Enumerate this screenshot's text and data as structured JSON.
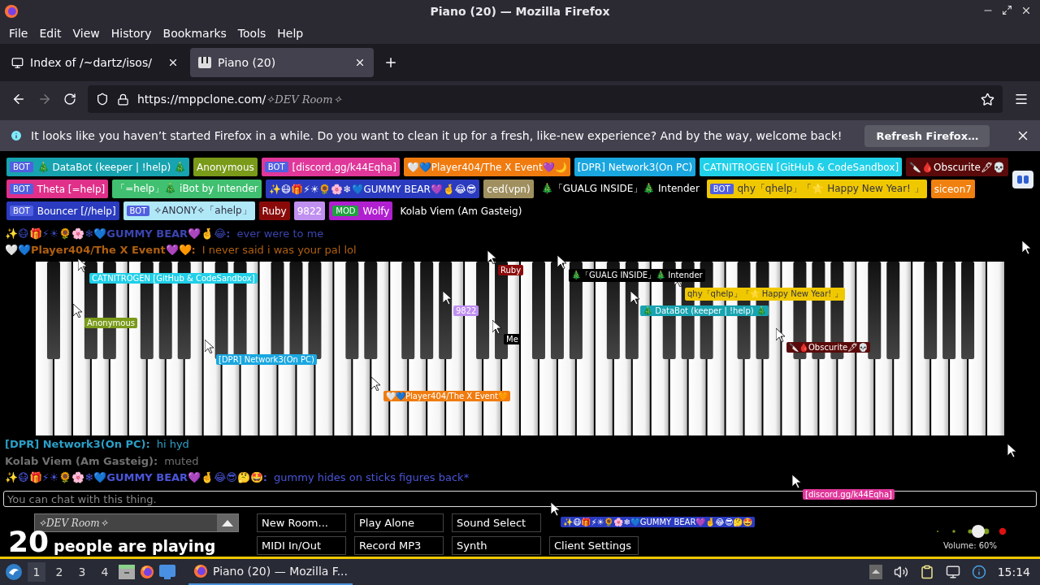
{
  "window": {
    "title": "Piano (20) — Mozilla Firefox"
  },
  "menu": [
    "File",
    "Edit",
    "View",
    "History",
    "Bookmarks",
    "Tools",
    "Help"
  ],
  "tabs": [
    {
      "label": "Index of /~dartz/isos/",
      "selected": false
    },
    {
      "label": "Piano (20)",
      "selected": true
    }
  ],
  "address": {
    "host": "https://mppclone.com/",
    "room": "✧DEV Room✧"
  },
  "notification": {
    "message": "It looks like you haven’t started Firefox in a while. Do you want to clean it up for a fresh, like-new experience? And by the way, welcome back!",
    "button": "Refresh Firefox…"
  },
  "users": [
    {
      "badge": {
        "label": "BOT",
        "color": "#5060e0"
      },
      "name": "🎄 DataBot (keeper | !help) 🎄",
      "color": "#17a3b0"
    },
    {
      "name": "Anonymous",
      "color": "#7a9a1a"
    },
    {
      "badge": {
        "label": "BOT",
        "color": "#5060e0"
      },
      "name": "[discord.gg/k44Eqha]",
      "color": "#e0379a"
    },
    {
      "name": "🤍💙Player404/The X Event💜🌙",
      "color": "#f07c10"
    },
    {
      "name": "[DPR] Network3(On PC)",
      "color": "#1aa7e0"
    },
    {
      "name": "CATNITROGEN [GitHub & CodeSandbox]",
      "color": "#20d0e8"
    },
    {
      "name": "🔪🩸Obscurite🖋💀",
      "color": "#5a0a0a"
    },
    {
      "badge": {
        "label": "BOT",
        "color": "#5060e0"
      },
      "name": "Theta [=help]",
      "color": "#e0308a"
    },
    {
      "name": "「=help」🎄 iBot by Intender",
      "color": "#40c070"
    },
    {
      "name": "✨😷🎁⚡☀🌻🌸❄💙GUMMY BEAR💜🤞😂😎",
      "color": "#2a3bc0"
    },
    {
      "name": "ced(vpn)",
      "color": "#a09060"
    },
    {
      "name": "🎄「GUALG INSIDE」🎄 Intender",
      "color": "#000000"
    },
    {
      "badge": {
        "label": "BOT",
        "color": "#5060e0"
      },
      "name": "qhy「qhelp」「🌟 Happy New Year! 」",
      "color": "#f0c800"
    },
    {
      "name": "siceon7",
      "color": "#f08010"
    },
    {
      "badge": {
        "label": "BOT",
        "color": "#5060e0"
      },
      "name": "Bouncer [//help]",
      "color": "#2a3bc0"
    },
    {
      "badge": {
        "label": "BOT",
        "color": "#5060e0"
      },
      "name": "✧ANONY✧「ahelp」",
      "color": "#b0e8f8"
    },
    {
      "name": "Ruby",
      "color": "#8a0a0a"
    },
    {
      "name": "9822",
      "color": "#c090f0"
    },
    {
      "badge": {
        "label": "MOD",
        "color": "#20a040"
      },
      "name": "Wolfy",
      "color": "#b020d0"
    },
    {
      "name": "Kolab Viem (Am Gasteig)",
      "color": "#000000"
    }
  ],
  "cursors": [
    {
      "label": "CATNITROGEN [GitHub & CodeSandbox]",
      "color": "#20d0e8"
    },
    {
      "label": "Ruby",
      "color": "#8a0a0a"
    },
    {
      "label": "🎄「GUALG INSIDE」🎄 Intender",
      "color": "#000000"
    },
    {
      "label": "Anonymous",
      "color": "#7a9a1a"
    },
    {
      "label": "9822",
      "color": "#c090f0"
    },
    {
      "label": "Me",
      "color": "#000000"
    },
    {
      "label": "🔪🩸Obscurite🖋💀",
      "color": "#5a0a0a"
    },
    {
      "label": "[DPR] Network3(On PC)",
      "color": "#1aa7e0"
    },
    {
      "label": "qhy「qhelp」「🌟 Happy New Year! 」",
      "color": "#f0c800"
    },
    {
      "label": "🎄 DataBot (keeper | !help) 🎄",
      "color": "#17a3b0"
    },
    {
      "label": "🤍💙Player404/The X Event🧡",
      "color": "#f07c10"
    },
    {
      "label": "[discord.gg/k44Eqha]",
      "color": "#e0379a"
    },
    {
      "label": "✨😷🎁⚡☀🌻🌸❄💙GUMMY BEAR💜🤞😂😎🤔🤩",
      "color": "#2a3bc0"
    }
  ],
  "chat_above": [
    {
      "name": "✨😷🎁⚡☀🌻🌸❄💙GUMMY BEAR💜🤞😂:",
      "message": "ever were to me",
      "color": "#3a45b0"
    },
    {
      "name": "🤍💙Player404/The X Event💜🧡:",
      "message": "I never said i was your pal lol",
      "color": "#b06010"
    }
  ],
  "chat_below": [
    {
      "name": "[DPR] Network3(On PC):",
      "message": "hi hyd",
      "color": "#2aa0c8"
    },
    {
      "name": "Kolab Viem (Am Gasteig):",
      "message": "muted",
      "color": "#707070"
    },
    {
      "name": "✨😷🎁⚡☀🌻🌸❄💙GUMMY BEAR💜🤞😂😎🤔🤩:",
      "message": "gummy hides on sticks figures back*",
      "color": "#4a55d8"
    }
  ],
  "chat_input": {
    "placeholder": "You can chat with this thing."
  },
  "room": {
    "name": "✧DEV Room✧"
  },
  "player_count": {
    "count": "20",
    "label": "people are playing"
  },
  "buttons": [
    [
      "New Room...",
      "Play Alone",
      "Sound Select"
    ],
    [
      "MIDI In/Out",
      "Record MP3",
      "Synth",
      "Client Settings"
    ]
  ],
  "volume": {
    "label": "Volume: 60%",
    "level": 0.6
  },
  "taskbar": {
    "workspaces": [
      {
        "label": "1",
        "selected": true
      },
      {
        "label": "2",
        "selected": false
      },
      {
        "label": "3",
        "selected": false
      },
      {
        "label": "4",
        "selected": false
      }
    ],
    "window": "Piano (20) — Mozilla F...",
    "clock": "15:14"
  }
}
